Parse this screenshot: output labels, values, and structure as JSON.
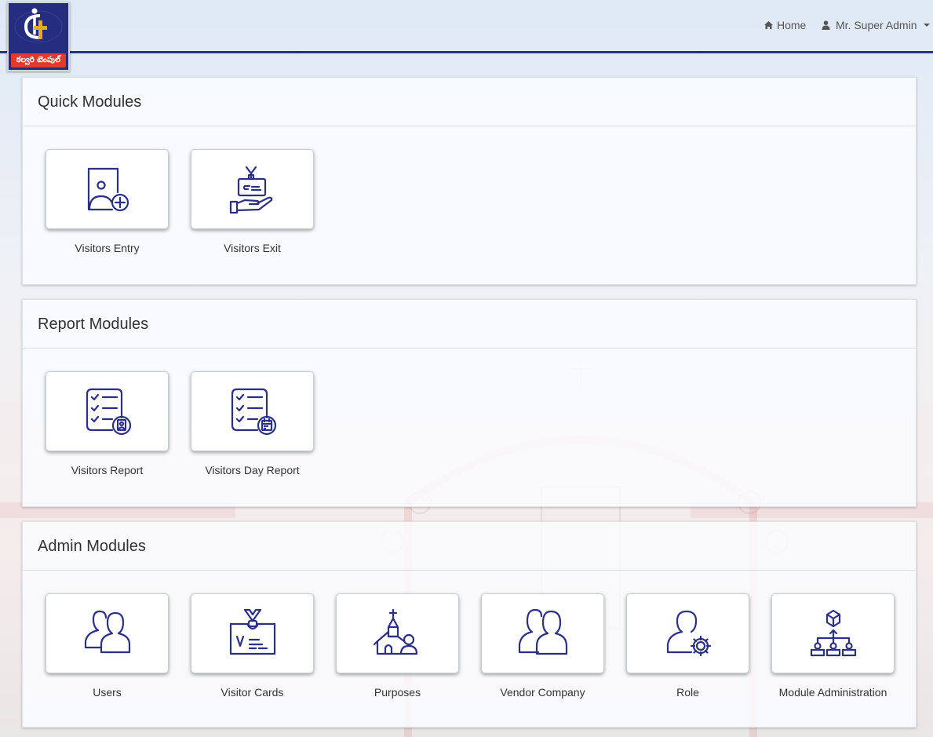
{
  "brand": {
    "logo_text": "కల్వరి టెంపుల్"
  },
  "nav": {
    "home_icon": "home-icon",
    "home_label": "Home",
    "user_icon": "user-icon",
    "user_label": "Mr. Super Admin"
  },
  "colors": {
    "accent": "#28318a",
    "icon": "#2b2f86",
    "logo_red": "#e33a2f"
  },
  "quick": {
    "title": "Quick Modules",
    "items": [
      {
        "label": "Visitors Entry",
        "icon": "visitor-add-icon"
      },
      {
        "label": "Visitors Exit",
        "icon": "id-card-hand-icon"
      }
    ]
  },
  "report": {
    "title": "Report Modules",
    "items": [
      {
        "label": "Visitors Report",
        "icon": "checklist-person-icon"
      },
      {
        "label": "Visitors Day Report",
        "icon": "checklist-calendar-icon"
      }
    ]
  },
  "admin": {
    "title": "Admin Modules",
    "items": [
      {
        "label": "Users",
        "icon": "users-icon"
      },
      {
        "label": "Visitor Cards",
        "icon": "visitor-card-icon"
      },
      {
        "label": "Purposes",
        "icon": "church-person-icon"
      },
      {
        "label": "Vendor Company",
        "icon": "vendor-people-icon"
      },
      {
        "label": "Role",
        "icon": "user-gear-icon"
      },
      {
        "label": "Module Administration",
        "icon": "org-chart-icon"
      }
    ]
  }
}
